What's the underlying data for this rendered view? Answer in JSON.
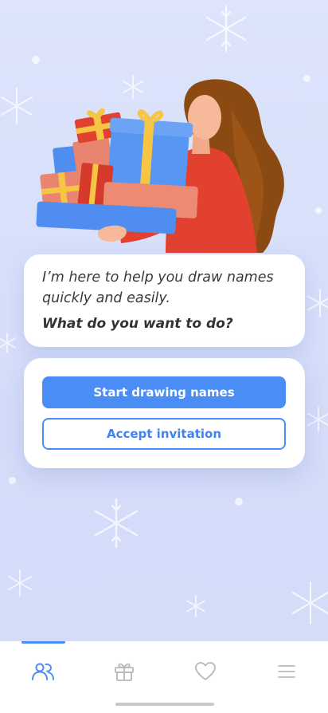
{
  "speech": {
    "line1": "I’m here to help you draw names",
    "line2": "quickly and easily.",
    "question": "What do you want to do?"
  },
  "actions": {
    "start_label": "Start drawing names",
    "accept_label": "Accept invitation"
  },
  "nav": {
    "items": [
      {
        "icon": "people-icon",
        "active": true
      },
      {
        "icon": "gift-icon",
        "active": false
      },
      {
        "icon": "heart-icon",
        "active": false
      },
      {
        "icon": "menu-icon",
        "active": false
      }
    ]
  },
  "colors": {
    "accent": "#4a8ef5",
    "background": "#d8e0fa",
    "inactive_icon": "#b8b8b8"
  }
}
